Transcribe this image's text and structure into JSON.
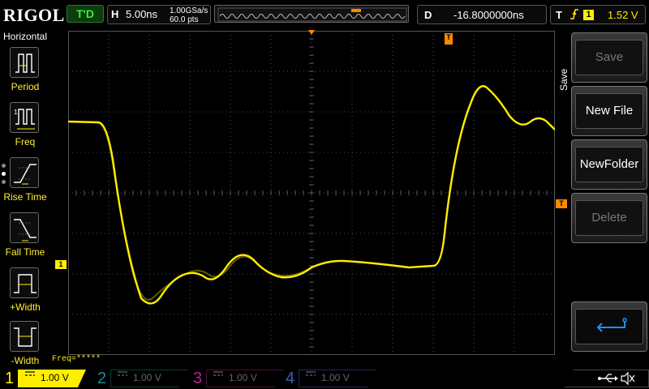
{
  "header": {
    "logo": "RIGOL",
    "run_status": "T'D",
    "horizontal": {
      "label": "H",
      "timebase": "5.00ns",
      "sample_rate": "1.00GSa/s",
      "points": "60.0 pts"
    },
    "delay": {
      "label": "D",
      "value": "-16.8000000ns"
    },
    "trigger": {
      "label": "T",
      "edge_icon": "rising-edge-icon",
      "source": "1",
      "level": "1.52 V"
    }
  },
  "left_menu": {
    "title": "Horizontal",
    "items": [
      {
        "label": "Period",
        "icon": "period-icon"
      },
      {
        "label": "Freq",
        "icon": "frequency-icon"
      },
      {
        "label": "Rise Time",
        "icon": "rise-time-icon"
      },
      {
        "label": "Fall Time",
        "icon": "fall-time-icon"
      },
      {
        "label": "+Width",
        "icon": "positive-width-icon"
      },
      {
        "label": "-Width",
        "icon": "negative-width-icon"
      }
    ]
  },
  "screen": {
    "freq_readout": "Freq=*****",
    "trigger_position_marker": "T",
    "ch1_marker": "1",
    "trace_color": "#ffee00",
    "grid_divisions": {
      "x": 12,
      "y": 8
    }
  },
  "right_menu": {
    "title": "Save",
    "buttons": [
      {
        "label": "Save",
        "enabled": false
      },
      {
        "label": "New File",
        "enabled": true
      },
      {
        "label": "NewFolder",
        "enabled": true
      },
      {
        "label": "Delete",
        "enabled": false
      }
    ],
    "back_icon": "return-arrow-icon"
  },
  "channels": [
    {
      "number": "1",
      "scale": "1.00 V",
      "active": true,
      "color": "#ffee00"
    },
    {
      "number": "2",
      "scale": "1.00 V",
      "active": false,
      "color": "#1e8a8a"
    },
    {
      "number": "3",
      "scale": "1.00 V",
      "active": false,
      "color": "#b02890"
    },
    {
      "number": "4",
      "scale": "1.00 V",
      "active": false,
      "color": "#3062c0"
    }
  ],
  "system_icons": [
    "usb-icon",
    "speaker-muted-icon"
  ]
}
